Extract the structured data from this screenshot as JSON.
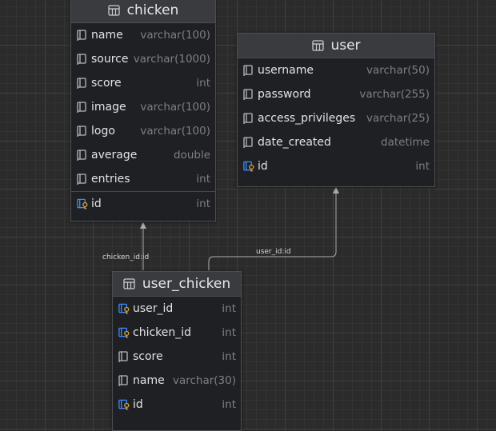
{
  "tables": {
    "chicken": {
      "name": "chicken",
      "columns": [
        {
          "name": "name",
          "type": "varchar(100)"
        },
        {
          "name": "source",
          "type": "varchar(1000)"
        },
        {
          "name": "score",
          "type": "int"
        },
        {
          "name": "image",
          "type": "varchar(100)"
        },
        {
          "name": "logo",
          "type": "varchar(100)"
        },
        {
          "name": "average",
          "type": "double"
        },
        {
          "name": "entries",
          "type": "int"
        },
        {
          "name": "id",
          "type": "int",
          "key": "primary"
        }
      ]
    },
    "user": {
      "name": "user",
      "columns": [
        {
          "name": "username",
          "type": "varchar(50)"
        },
        {
          "name": "password",
          "type": "varchar(255)"
        },
        {
          "name": "access_privileges",
          "type": "varchar(25)"
        },
        {
          "name": "date_created",
          "type": "datetime"
        },
        {
          "name": "id",
          "type": "int",
          "key": "primary"
        }
      ]
    },
    "user_chicken": {
      "name": "user_chicken",
      "columns": [
        {
          "name": "user_id",
          "type": "int",
          "key": "foreign"
        },
        {
          "name": "chicken_id",
          "type": "int",
          "key": "foreign"
        },
        {
          "name": "score",
          "type": "int"
        },
        {
          "name": "name",
          "type": "varchar(30)"
        },
        {
          "name": "id",
          "type": "int",
          "key": "primary"
        }
      ]
    }
  },
  "relations": {
    "chicken_link": "chicken_id:id",
    "user_link": "user_id:id"
  },
  "colors": {
    "background": "#2b2b2b",
    "table_body": "#1f2023",
    "table_header": "#3a3b3f",
    "key_blue": "#3d8bfd",
    "key_gold": "#d6a23a",
    "line": "#a8aaae"
  }
}
